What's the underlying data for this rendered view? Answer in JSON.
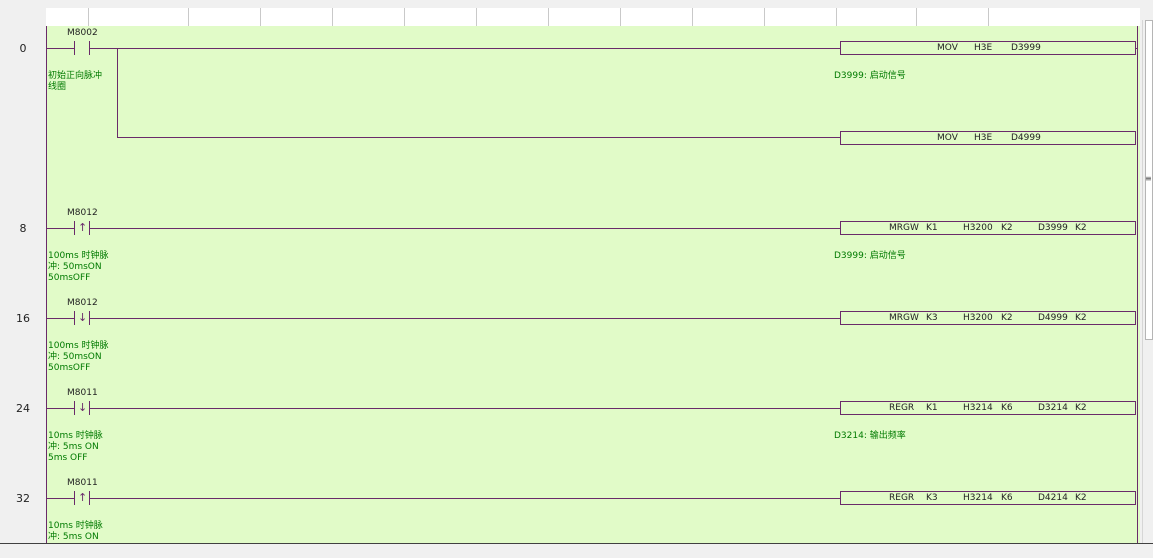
{
  "steps": [
    "0",
    "8",
    "16",
    "24",
    "32"
  ],
  "rungs": [
    {
      "contact": "M8002",
      "contact_type": "normally-open",
      "comment": "初始正向脉冲\n线圈",
      "instructions": [
        {
          "op": "MOV",
          "args": [
            "H3E",
            "D3999"
          ],
          "comment": "D3999: 启动信号"
        },
        {
          "op": "MOV",
          "args": [
            "H3E",
            "D4999"
          ]
        }
      ]
    },
    {
      "contact": "M8012",
      "contact_type": "rising-edge",
      "comment": "100ms 时钟脉\n冲: 50msON\n50msOFF",
      "instructions": [
        {
          "op": "MRGW",
          "args": [
            "K1",
            "H3200",
            "K2",
            "D3999",
            "K2"
          ],
          "comment": "D3999: 启动信号"
        }
      ]
    },
    {
      "contact": "M8012",
      "contact_type": "falling-edge",
      "comment": "100ms 时钟脉\n冲: 50msON\n50msOFF",
      "instructions": [
        {
          "op": "MRGW",
          "args": [
            "K3",
            "H3200",
            "K2",
            "D4999",
            "K2"
          ]
        }
      ]
    },
    {
      "contact": "M8011",
      "contact_type": "falling-edge",
      "comment": "10ms 时钟脉\n冲: 5ms ON\n5ms OFF",
      "instructions": [
        {
          "op": "REGR",
          "args": [
            "K1",
            "H3214",
            "K6",
            "D3214",
            "K2"
          ],
          "comment": "D3214: 输出频率"
        }
      ]
    },
    {
      "contact": "M8011",
      "contact_type": "rising-edge",
      "comment": "10ms 时钟脉\n冲: 5ms ON",
      "instructions": [
        {
          "op": "REGR",
          "args": [
            "K3",
            "H3214",
            "K6",
            "D4214",
            "K2"
          ]
        }
      ]
    }
  ],
  "icons": {
    "rising_edge": "↑",
    "falling_edge": "↓"
  },
  "colors": {
    "canvas": "#e1fbc8",
    "wire": "#6a2a6a",
    "comment": "#007a00"
  }
}
